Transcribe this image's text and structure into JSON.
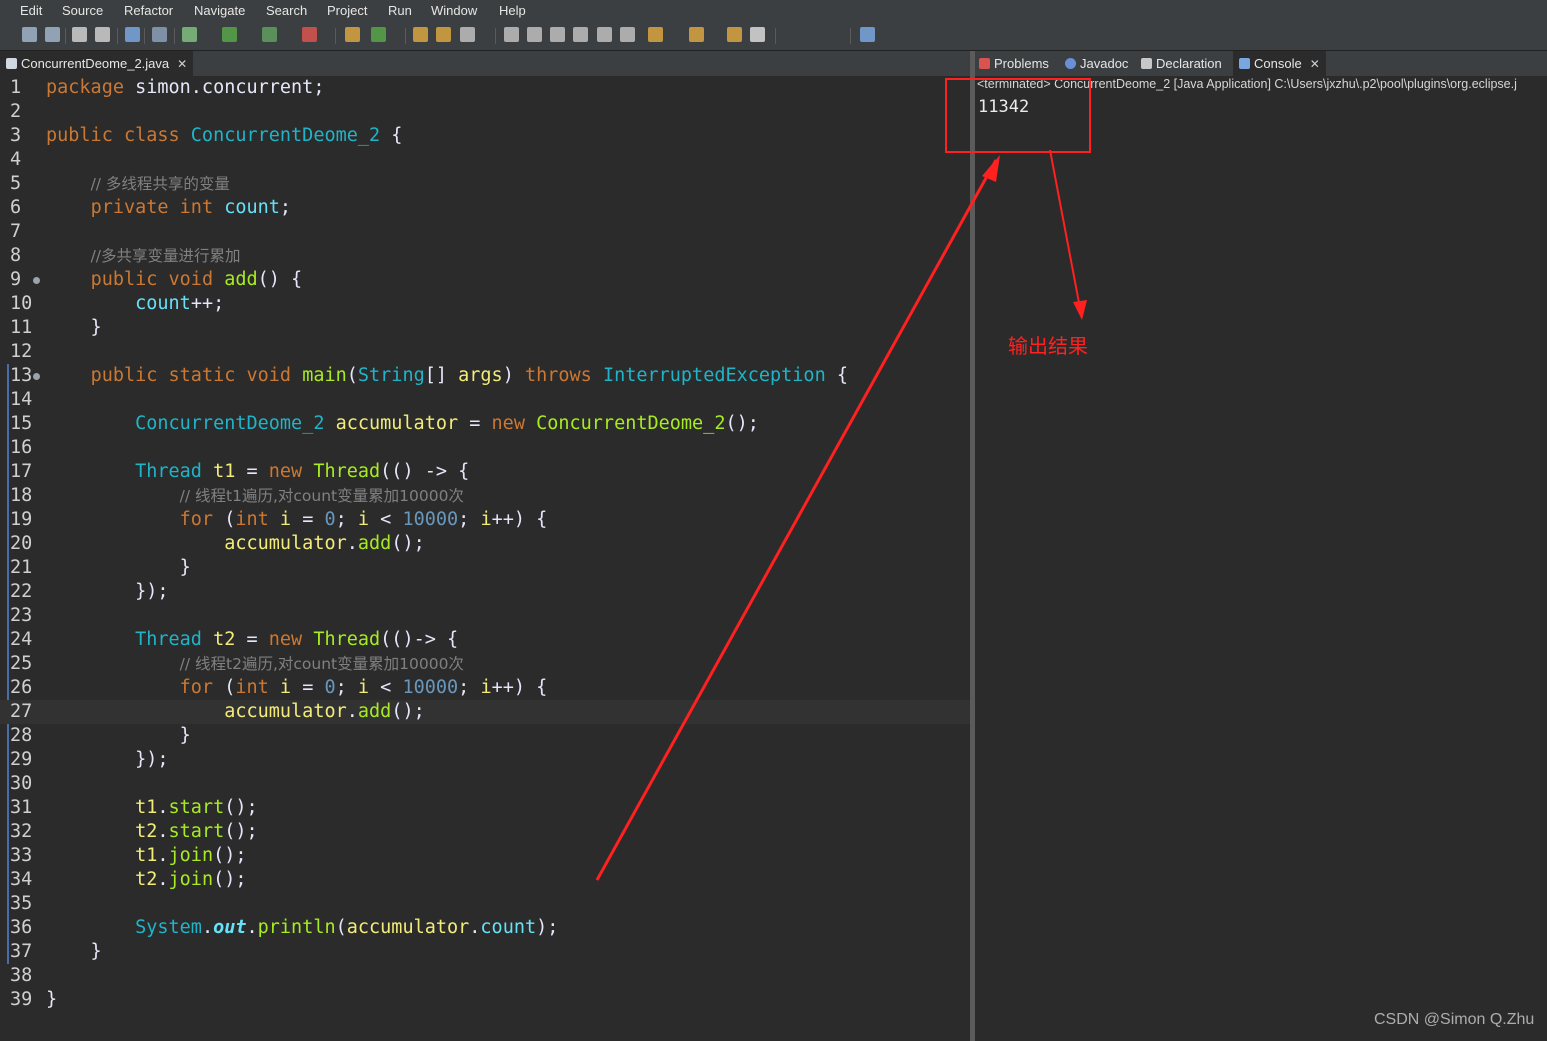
{
  "menu": [
    "Edit",
    "Source",
    "Refactor",
    "Navigate",
    "Search",
    "Project",
    "Run",
    "Window",
    "Help"
  ],
  "editor_tab": {
    "label": "ConcurrentDeome_2.java",
    "close": "✕"
  },
  "console_tabs": [
    {
      "label": "Problems",
      "icon": "problems-icon"
    },
    {
      "label": "Javadoc",
      "icon": "javadoc-icon"
    },
    {
      "label": "Declaration",
      "icon": "declaration-icon"
    },
    {
      "label": "Console",
      "icon": "console-icon",
      "active": true,
      "close": "✕"
    }
  ],
  "code_lines": [
    [
      [
        "kw",
        "package "
      ],
      [
        "pu",
        "simon.concurrent;"
      ]
    ],
    [],
    [
      [
        "kw",
        "public class "
      ],
      [
        "ty",
        "ConcurrentDeome_2"
      ],
      [
        "pu",
        " {"
      ]
    ],
    [],
    [
      [
        "pu",
        "    "
      ],
      [
        "cm",
        "// 多线程共享的变量"
      ]
    ],
    [
      [
        "pu",
        "    "
      ],
      [
        "kw",
        "private int "
      ],
      [
        "fd",
        "count"
      ],
      [
        "pu",
        ";"
      ]
    ],
    [],
    [
      [
        "pu",
        "    "
      ],
      [
        "cm",
        "//多共享变量进行累加"
      ]
    ],
    [
      [
        "pu",
        "    "
      ],
      [
        "kw",
        "public void "
      ],
      [
        "fn",
        "add"
      ],
      [
        "pu",
        "() {"
      ]
    ],
    [
      [
        "pu",
        "        "
      ],
      [
        "fd",
        "count"
      ],
      [
        "pu",
        "++;"
      ]
    ],
    [
      [
        "pu",
        "    }"
      ]
    ],
    [],
    [
      [
        "pu",
        "    "
      ],
      [
        "kw",
        "public static void "
      ],
      [
        "fn",
        "main"
      ],
      [
        "pu",
        "("
      ],
      [
        "ty",
        "String"
      ],
      [
        "pu",
        "[] "
      ],
      [
        "va",
        "args"
      ],
      [
        "pu",
        ") "
      ],
      [
        "kw",
        "throws "
      ],
      [
        "ty",
        "InterruptedException"
      ],
      [
        "pu",
        " {"
      ]
    ],
    [],
    [
      [
        "pu",
        "        "
      ],
      [
        "ty",
        "ConcurrentDeome_2 "
      ],
      [
        "va",
        "accumulator"
      ],
      [
        "pu",
        " = "
      ],
      [
        "kw",
        "new "
      ],
      [
        "fn",
        "ConcurrentDeome_2"
      ],
      [
        "pu",
        "();"
      ]
    ],
    [],
    [
      [
        "pu",
        "        "
      ],
      [
        "ty",
        "Thread "
      ],
      [
        "va",
        "t1"
      ],
      [
        "pu",
        " = "
      ],
      [
        "kw",
        "new "
      ],
      [
        "fn",
        "Thread"
      ],
      [
        "pu",
        "(() -> {"
      ]
    ],
    [
      [
        "pu",
        "            "
      ],
      [
        "cm",
        "// 线程t1遍历,对count变量累加10000次"
      ]
    ],
    [
      [
        "pu",
        "            "
      ],
      [
        "kw",
        "for "
      ],
      [
        "pu",
        "("
      ],
      [
        "kw",
        "int "
      ],
      [
        "va",
        "i"
      ],
      [
        "pu",
        " = "
      ],
      [
        "nu",
        "0"
      ],
      [
        "pu",
        "; "
      ],
      [
        "va",
        "i"
      ],
      [
        "pu",
        " < "
      ],
      [
        "nu",
        "10000"
      ],
      [
        "pu",
        "; "
      ],
      [
        "va",
        "i"
      ],
      [
        "pu",
        "++) {"
      ]
    ],
    [
      [
        "pu",
        "                "
      ],
      [
        "va",
        "accumulator"
      ],
      [
        "pu",
        "."
      ],
      [
        "fn",
        "add"
      ],
      [
        "pu",
        "();"
      ]
    ],
    [
      [
        "pu",
        "            }"
      ]
    ],
    [
      [
        "pu",
        "        });"
      ]
    ],
    [],
    [
      [
        "pu",
        "        "
      ],
      [
        "ty",
        "Thread "
      ],
      [
        "va",
        "t2"
      ],
      [
        "pu",
        " = "
      ],
      [
        "kw",
        "new "
      ],
      [
        "fn",
        "Thread"
      ],
      [
        "pu",
        "(()-> {"
      ]
    ],
    [
      [
        "pu",
        "            "
      ],
      [
        "cm",
        "// 线程t2遍历,对count变量累加10000次"
      ]
    ],
    [
      [
        "pu",
        "            "
      ],
      [
        "kw",
        "for "
      ],
      [
        "pu",
        "("
      ],
      [
        "kw",
        "int "
      ],
      [
        "va",
        "i"
      ],
      [
        "pu",
        " = "
      ],
      [
        "nu",
        "0"
      ],
      [
        "pu",
        "; "
      ],
      [
        "va",
        "i"
      ],
      [
        "pu",
        " < "
      ],
      [
        "nu",
        "10000"
      ],
      [
        "pu",
        "; "
      ],
      [
        "va",
        "i"
      ],
      [
        "pu",
        "++) {"
      ]
    ],
    [
      [
        "pu",
        "                "
      ],
      [
        "va",
        "accumulator"
      ],
      [
        "pu",
        "."
      ],
      [
        "fn",
        "add"
      ],
      [
        "pu",
        "();"
      ]
    ],
    [
      [
        "pu",
        "            }"
      ]
    ],
    [
      [
        "pu",
        "        });"
      ]
    ],
    [],
    [
      [
        "pu",
        "        "
      ],
      [
        "va",
        "t1"
      ],
      [
        "pu",
        "."
      ],
      [
        "fn",
        "start"
      ],
      [
        "pu",
        "();"
      ]
    ],
    [
      [
        "pu",
        "        "
      ],
      [
        "va",
        "t2"
      ],
      [
        "pu",
        "."
      ],
      [
        "fn",
        "start"
      ],
      [
        "pu",
        "();"
      ]
    ],
    [
      [
        "pu",
        "        "
      ],
      [
        "va",
        "t1"
      ],
      [
        "pu",
        "."
      ],
      [
        "fn",
        "join"
      ],
      [
        "pu",
        "();"
      ]
    ],
    [
      [
        "pu",
        "        "
      ],
      [
        "va",
        "t2"
      ],
      [
        "pu",
        "."
      ],
      [
        "fn",
        "join"
      ],
      [
        "pu",
        "();"
      ]
    ],
    [],
    [
      [
        "pu",
        "        "
      ],
      [
        "ty",
        "System"
      ],
      [
        "pu",
        "."
      ],
      [
        "st",
        "out"
      ],
      [
        "pu",
        "."
      ],
      [
        "fn",
        "println"
      ],
      [
        "pu",
        "("
      ],
      [
        "va",
        "accumulator"
      ],
      [
        "pu",
        "."
      ],
      [
        "fd",
        "count"
      ],
      [
        "pu",
        ");"
      ]
    ],
    [
      [
        "pu",
        "    }"
      ]
    ],
    [],
    [
      [
        "pu",
        "}"
      ]
    ]
  ],
  "method_marker_lines": [
    9,
    13
  ],
  "current_line": 27,
  "console": {
    "header": "<terminated> ConcurrentDeome_2 [Java Application] C:\\Users\\jxzhu\\.p2\\pool\\plugins\\org.eclipse.j",
    "output": "11342"
  },
  "annotation": {
    "label": "输出结果",
    "color": "#ff2020"
  },
  "watermark": "CSDN @Simon Q.Zhu"
}
